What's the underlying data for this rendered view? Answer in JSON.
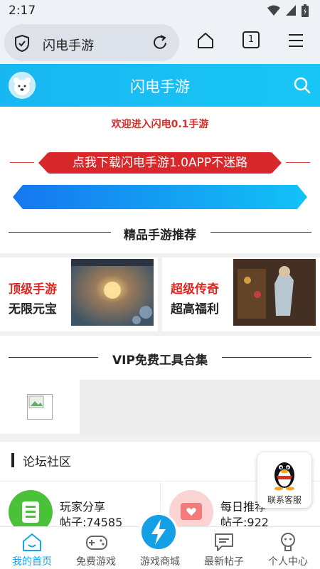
{
  "status_bar": {
    "time": "2:17",
    "icons": [
      "wifi-icon",
      "signal-icon",
      "battery-icon"
    ]
  },
  "browser": {
    "url_text": "闪电手游",
    "tab_count": "1"
  },
  "header": {
    "title": "闪电手游"
  },
  "welcome_text": "欢迎进入闪电0.1手游",
  "download_banner": "点我下载闪电手游1.0APP不迷路",
  "recommend": {
    "title": "精品手游推荐",
    "cards": [
      {
        "title": "顶级手游",
        "subtitle": "无限元宝"
      },
      {
        "title": "超级传奇",
        "subtitle": "超高福利"
      }
    ]
  },
  "vip": {
    "title": "VIP免费工具合集"
  },
  "forum": {
    "title": "论坛社区",
    "items": [
      {
        "name": "玩家分享",
        "count": "帖子:74585"
      },
      {
        "name": "每日推荐",
        "count": "帖子:922"
      }
    ]
  },
  "customer_service": {
    "label": "联系客服"
  },
  "bottom_nav": {
    "items": [
      {
        "label": "我的首页",
        "active": true
      },
      {
        "label": "免费游戏"
      },
      {
        "label": "游戏商城"
      },
      {
        "label": "最新帖子"
      },
      {
        "label": "个人中心"
      }
    ]
  },
  "colors": {
    "accent": "#18b7f2",
    "red": "#d8282c",
    "active_nav": "#1aa3e8"
  }
}
